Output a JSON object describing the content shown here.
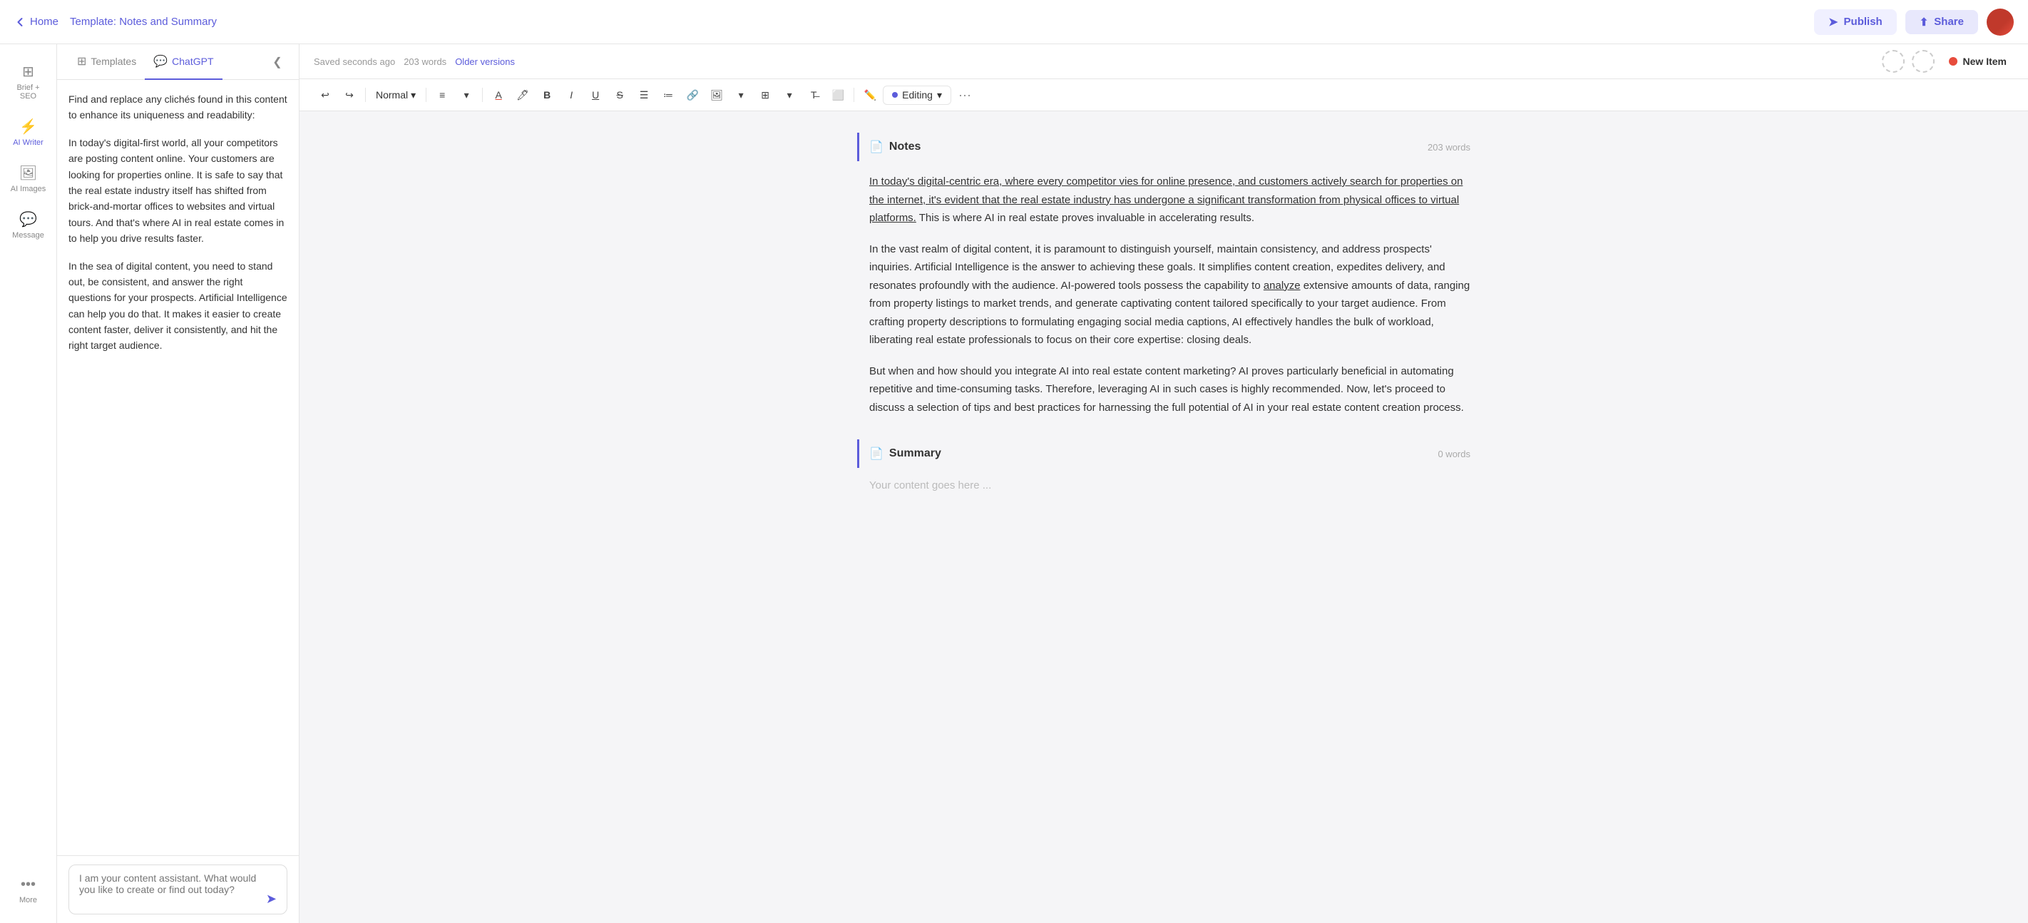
{
  "header": {
    "home_label": "Home",
    "breadcrumb_prefix": "Template: ",
    "breadcrumb_link": "Notes and Summary",
    "publish_label": "Publish",
    "share_label": "Share"
  },
  "sidebar": {
    "items": [
      {
        "id": "brief-seo",
        "icon": "⊞",
        "label": "Brief + SEO",
        "active": false
      },
      {
        "id": "ai-writer",
        "icon": "⚡",
        "label": "AI Writer",
        "active": true
      },
      {
        "id": "ai-images",
        "icon": "🖼",
        "label": "AI Images",
        "active": false
      },
      {
        "id": "message",
        "icon": "💬",
        "label": "Message",
        "active": false
      },
      {
        "id": "more",
        "icon": "···",
        "label": "More",
        "active": false
      }
    ]
  },
  "panel": {
    "tabs": [
      {
        "id": "templates",
        "icon": "⊞",
        "label": "Templates"
      },
      {
        "id": "chatgpt",
        "icon": "💬",
        "label": "ChatGPT",
        "active": true
      }
    ],
    "content": [
      "Find and replace any clichés found in this content to enhance its uniqueness and readability:",
      "In today's digital-first world, all your competitors are posting content online. Your customers are looking for properties online. It is safe to say that the real estate industry itself has shifted from brick-and-mortar offices to websites and virtual tours. And that's where AI in real estate comes in to help you drive results faster.",
      "In the sea of digital content, you need to stand out, be consistent, and answer the right questions for your prospects. Artificial Intelligence can help you do that. It makes it easier to create content faster, deliver it consistently, and hit the right target audience."
    ],
    "chat_placeholder": "I am your content assistant. What would you like to create or find out today?"
  },
  "editor": {
    "saved_label": "Saved seconds ago",
    "word_count": "203 words",
    "older_versions_label": "Older versions",
    "new_item_label": "New Item",
    "toolbar": {
      "style_dropdown": "Normal",
      "editing_label": "Editing"
    },
    "sections": [
      {
        "id": "notes",
        "icon": "📄",
        "title": "Notes",
        "words": "203 words",
        "paragraphs": [
          {
            "text": "In today's digital-centric era, where every competitor vies for online presence, and customers actively search for properties on the internet, it's evident that the real estate industry has undergone a significant transformation from physical offices to virtual platforms.",
            "underline": true,
            "continuation": " This is where AI in real estate proves invaluable in accelerating results."
          },
          {
            "text": "In the vast realm of digital content, it is paramount to distinguish yourself, maintain consistency, and address prospects' inquiries. Artificial Intelligence is the answer to achieving these goals. It simplifies content creation, expedites delivery, and resonates profoundly with the audience. AI-powered tools possess the capability to analyze extensive amounts of data, ranging from property listings to market trends, and generate captivating content tailored specifically to your target audience. From crafting property descriptions to formulating engaging social media captions, AI effectively handles the bulk of workload, liberating real estate professionals to focus on their core expertise: closing deals.",
            "underline": false
          },
          {
            "text": "But when and how should you integrate AI into real estate content marketing? AI proves particularly beneficial in automating repetitive and time-consuming tasks. Therefore, leveraging AI in such cases is highly recommended. Now, let's proceed to discuss a selection of tips and best practices for harnessing the full potential of AI in your real estate content creation process.",
            "underline": false
          }
        ]
      },
      {
        "id": "summary",
        "icon": "📄",
        "title": "Summary",
        "words": "0 words",
        "placeholder": "Your content goes here ..."
      }
    ]
  }
}
